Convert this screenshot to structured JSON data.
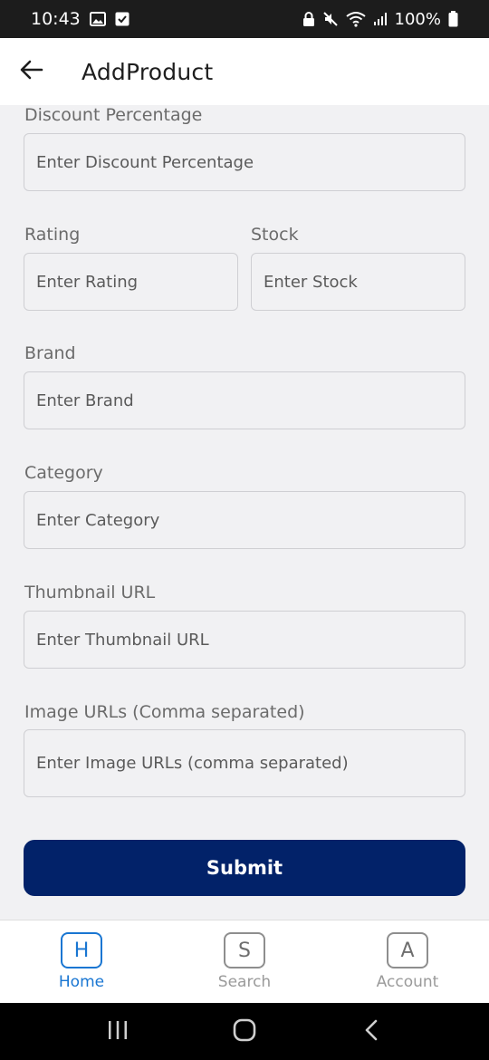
{
  "status_bar": {
    "time": "10:43",
    "battery": "100%",
    "icons": [
      "gallery-icon",
      "check-box-icon",
      "lock-icon",
      "mute-icon",
      "wifi-icon",
      "signal-icon",
      "battery-icon"
    ]
  },
  "app_bar": {
    "title": "AddProduct",
    "back_icon": "arrow-left-icon"
  },
  "form": {
    "discount": {
      "label": "Discount Percentage",
      "placeholder": "Enter Discount Percentage"
    },
    "rating": {
      "label": "Rating",
      "placeholder": "Enter Rating"
    },
    "stock": {
      "label": "Stock",
      "placeholder": "Enter Stock"
    },
    "brand": {
      "label": "Brand",
      "placeholder": "Enter Brand"
    },
    "category": {
      "label": "Category",
      "placeholder": "Enter Category"
    },
    "thumbnail": {
      "label": "Thumbnail URL",
      "placeholder": "Enter Thumbnail URL"
    },
    "images": {
      "label": "Image URLs (Comma separated)",
      "placeholder": "Enter Image URLs (comma separated)"
    },
    "submit_label": "Submit"
  },
  "bottom_nav": {
    "items": [
      {
        "letter": "H",
        "label": "Home",
        "active": true
      },
      {
        "letter": "S",
        "label": "Search",
        "active": false
      },
      {
        "letter": "A",
        "label": "Account",
        "active": false
      }
    ]
  },
  "colors": {
    "primary": "#022269",
    "active_nav": "#1976d2",
    "background": "#f1f1f3"
  }
}
